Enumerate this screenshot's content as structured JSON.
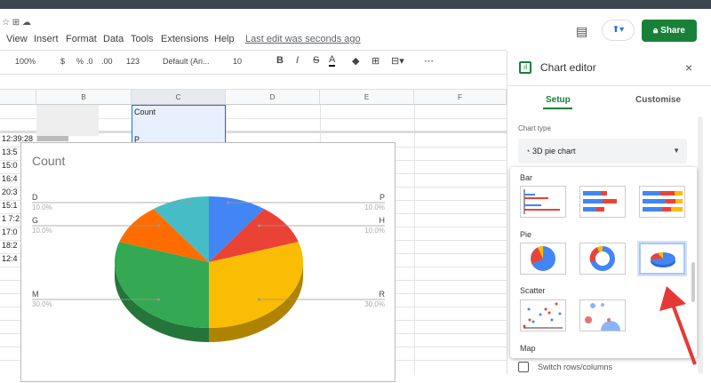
{
  "menu": {
    "items": [
      "View",
      "Insert",
      "Format",
      "Data",
      "Tools",
      "Extensions",
      "Help"
    ],
    "last_edit": "Last edit was seconds ago"
  },
  "toolbar": {
    "zoom": "100%",
    "currency": "$",
    "percent": "%",
    "dec_less": ".0",
    "dec_more": ".00",
    "format": "123",
    "font": "Default (Ari...",
    "size": "10",
    "bold": "B",
    "italic": "I",
    "strike": "S",
    "text_color": "A",
    "more": "⋯"
  },
  "header": {
    "share": "Share"
  },
  "sheet": {
    "columns": [
      "B",
      "C",
      "D",
      "E",
      "F"
    ],
    "c1": "Count",
    "c3": "P",
    "times": [
      "12:39:28",
      "13:5",
      "15:0",
      "16:4",
      "20:3",
      "15:1",
      "1 7:2",
      "17:0",
      "18:2",
      "12:4"
    ]
  },
  "chart_data": {
    "type": "pie",
    "variant": "3d",
    "title": "Count",
    "slices": [
      {
        "label": "P",
        "value": 10,
        "pct": "10.0%",
        "color": "#4285f4",
        "side": "right"
      },
      {
        "label": "H",
        "value": 10,
        "pct": "10.0%",
        "color": "#ea4335",
        "side": "right"
      },
      {
        "label": "R",
        "value": 30,
        "pct": "30.0%",
        "color": "#fbbc04",
        "side": "right"
      },
      {
        "label": "M",
        "value": 30,
        "pct": "30.0%",
        "color": "#34a853",
        "side": "left"
      },
      {
        "label": "G",
        "value": 10,
        "pct": "10.0%",
        "color": "#ff6d01",
        "side": "left"
      },
      {
        "label": "D",
        "value": 10,
        "pct": "10.0%",
        "color": "#46bdc6",
        "side": "left"
      }
    ]
  },
  "editor": {
    "title": "Chart editor",
    "tabs": [
      "Setup",
      "Customise"
    ],
    "chart_type_label": "Chart type",
    "chart_type": "3D pie chart",
    "sections": [
      "Bar",
      "Pie",
      "Scatter",
      "Map"
    ],
    "switch": "Switch rows/columns"
  }
}
